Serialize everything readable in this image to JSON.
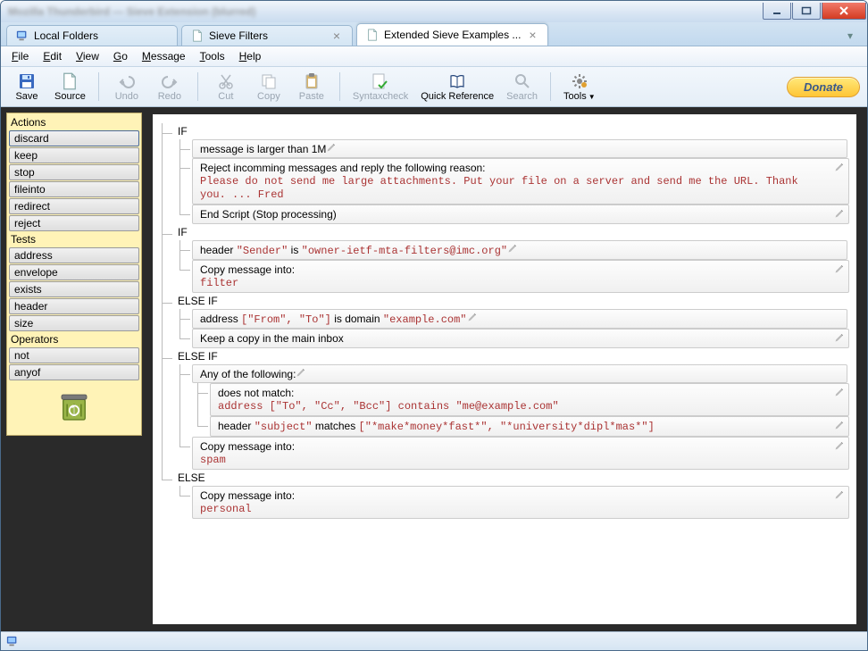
{
  "titlebar": {
    "blurred_text": "Mozilla Thunderbird — Sieve Extension (blurred)"
  },
  "tabs": [
    {
      "label": "Local Folders",
      "closable": false,
      "icon": "monitor-icon"
    },
    {
      "label": "Sieve Filters",
      "closable": true,
      "icon": "page-icon"
    },
    {
      "label": "Extended Sieve Examples ...",
      "closable": true,
      "icon": "page-icon",
      "active": true
    }
  ],
  "menu": [
    "File",
    "Edit",
    "View",
    "Go",
    "Message",
    "Tools",
    "Help"
  ],
  "toolbar": [
    {
      "name": "save",
      "label": "Save",
      "enabled": true,
      "icon": "disk-icon"
    },
    {
      "name": "source",
      "label": "Source",
      "enabled": true,
      "icon": "page-icon"
    },
    {
      "sep": true
    },
    {
      "name": "undo",
      "label": "Undo",
      "enabled": false,
      "icon": "undo-icon"
    },
    {
      "name": "redo",
      "label": "Redo",
      "enabled": false,
      "icon": "redo-icon"
    },
    {
      "sep": true
    },
    {
      "name": "cut",
      "label": "Cut",
      "enabled": false,
      "icon": "cut-icon"
    },
    {
      "name": "copy",
      "label": "Copy",
      "enabled": false,
      "icon": "copy-icon"
    },
    {
      "name": "paste",
      "label": "Paste",
      "enabled": false,
      "icon": "paste-icon"
    },
    {
      "sep": true
    },
    {
      "name": "syntaxcheck",
      "label": "Syntaxcheck",
      "enabled": false,
      "icon": "check-icon"
    },
    {
      "name": "quickref",
      "label": "Quick Reference",
      "enabled": true,
      "icon": "book-icon"
    },
    {
      "name": "search",
      "label": "Search",
      "enabled": false,
      "icon": "search-icon"
    },
    {
      "sep": true
    },
    {
      "name": "tools",
      "label": "Tools",
      "enabled": true,
      "icon": "gear-icon",
      "dropdown": true
    }
  ],
  "donate_label": "Donate",
  "palette": {
    "groups": [
      {
        "title": "Actions",
        "items": [
          "discard",
          "keep",
          "stop",
          "fileinto",
          "redirect",
          "reject"
        ]
      },
      {
        "title": "Tests",
        "items": [
          "address",
          "envelope",
          "exists",
          "header",
          "size"
        ]
      },
      {
        "title": "Operators",
        "items": [
          "not",
          "anyof"
        ]
      }
    ]
  },
  "editor": {
    "blocks": [
      {
        "kw": "IF",
        "cond": {
          "type": "headrow",
          "text": "message is larger than 1M"
        },
        "body": [
          {
            "type": "row",
            "plain": "Reject incomming messages and reply the following reason:",
            "mono": "Please do not send me large attachments. Put your file on a server and send me the URL. Thank you. ... Fred"
          },
          {
            "type": "row",
            "plain": "End Script (Stop processing)"
          }
        ]
      },
      {
        "kw": "IF",
        "cond": {
          "type": "headrow",
          "mixed": [
            "header ",
            "\"Sender\"",
            " is ",
            "\"owner-ietf-mta-filters@imc.org\""
          ]
        },
        "body": [
          {
            "type": "row",
            "plain": "Copy message into:",
            "mono": "filter"
          }
        ]
      },
      {
        "kw": "ELSE IF",
        "cond": {
          "type": "headrow",
          "mixed": [
            "address ",
            "[\"From\", \"To\"]",
            " is domain ",
            "\"example.com\""
          ]
        },
        "body": [
          {
            "type": "row",
            "plain": "Keep a copy in the main inbox"
          }
        ]
      },
      {
        "kw": "ELSE IF",
        "cond": {
          "type": "headrow",
          "text": "Any of the following:"
        },
        "extra": [
          {
            "type": "row",
            "plain": "does not match:",
            "mono": "address [\"To\", \"Cc\", \"Bcc\"] contains \"me@example.com\""
          },
          {
            "type": "row",
            "mixed": [
              "header ",
              "\"subject\"",
              " matches ",
              "[\"*make*money*fast*\", \"*university*dipl*mas*\"]"
            ]
          }
        ],
        "body": [
          {
            "type": "row",
            "plain": "Copy message into:",
            "mono": "spam"
          }
        ]
      },
      {
        "kw": "ELSE",
        "body": [
          {
            "type": "row",
            "plain": "Copy message into:",
            "mono": "personal"
          }
        ]
      }
    ]
  }
}
